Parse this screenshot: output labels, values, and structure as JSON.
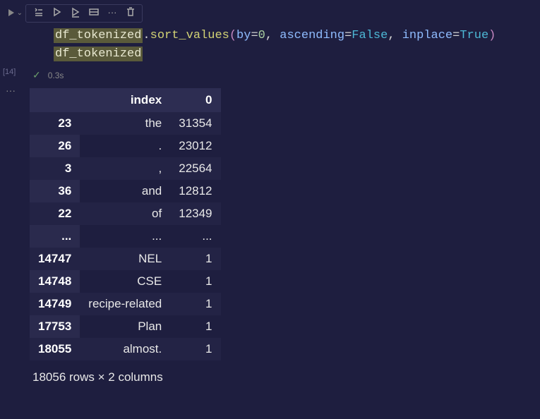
{
  "cell": {
    "exec_label": "[14]",
    "timing": "0.3s",
    "code_tokens": {
      "var1": "df_tokenized",
      "method": "sort_values",
      "param_by": "by",
      "val_by": "0",
      "param_asc": "ascending",
      "val_asc": "False",
      "param_inplace": "inplace",
      "val_inplace": "True",
      "var2": "df_tokenized"
    }
  },
  "gutter_ellipsis": "···",
  "table": {
    "headers": {
      "blank": "",
      "index": "index",
      "zero": "0"
    },
    "rows": [
      {
        "idx": "23",
        "index": "the",
        "zero": "31354"
      },
      {
        "idx": "26",
        "index": ".",
        "zero": "23012"
      },
      {
        "idx": "3",
        "index": ",",
        "zero": "22564"
      },
      {
        "idx": "36",
        "index": "and",
        "zero": "12812"
      },
      {
        "idx": "22",
        "index": "of",
        "zero": "12349"
      },
      {
        "idx": "...",
        "index": "...",
        "zero": "..."
      },
      {
        "idx": "14747",
        "index": "NEL",
        "zero": "1"
      },
      {
        "idx": "14748",
        "index": "CSE",
        "zero": "1"
      },
      {
        "idx": "14749",
        "index": "recipe-related",
        "zero": "1"
      },
      {
        "idx": "17753",
        "index": "Plan",
        "zero": "1"
      },
      {
        "idx": "18055",
        "index": "almost.",
        "zero": "1"
      }
    ],
    "shape": "18056 rows × 2 columns"
  },
  "toolbar": {
    "ellipsis": "···"
  }
}
